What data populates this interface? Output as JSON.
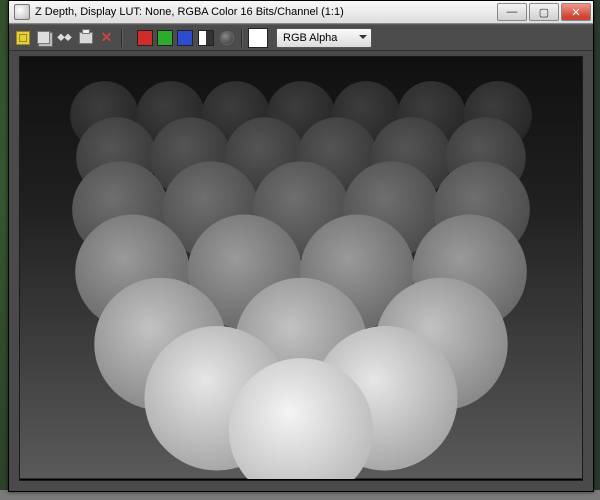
{
  "titlebar": {
    "title": "Z Depth, Display LUT: None, RGBA Color 16 Bits/Channel (1:1)",
    "min": "—",
    "max": "▢",
    "close": "✕"
  },
  "toolbar": {
    "clone_label": "⬥⬥",
    "swatches": {
      "red": "#d12c2c",
      "green": "#2cab2c",
      "blue": "#2c4cd1",
      "white": "#ffffff"
    },
    "channel_dropdown": {
      "selected": "RGB Alpha"
    }
  }
}
